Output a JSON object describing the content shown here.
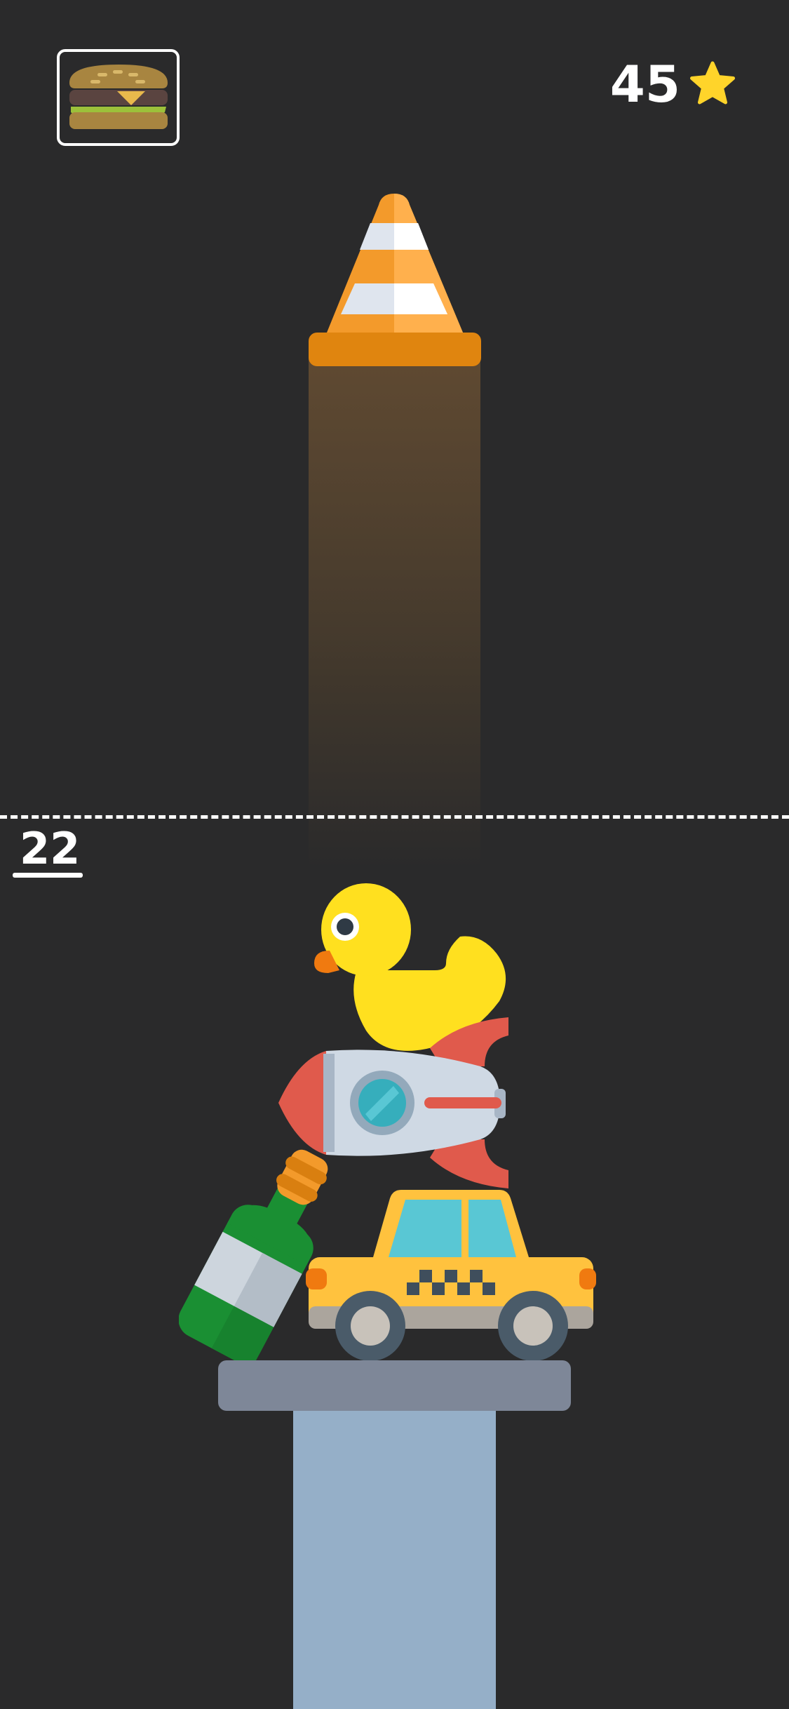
{
  "hud": {
    "next_item_icon": "burger-icon",
    "score": "45",
    "score_icon": "star-icon",
    "height": "22"
  },
  "items": {
    "held": "traffic-cone",
    "stack": [
      "rubber-duck",
      "rocket",
      "champagne-bottle",
      "taxi-car"
    ]
  },
  "colors": {
    "background": "#2a2a2b",
    "star": "#ffd42a",
    "pedestal_top": "#7e8798",
    "pedestal_column": "#95afc8",
    "cone_orange": "#f39a2b",
    "duck_yellow": "#ffe01f",
    "taxi_yellow": "#ffc23e",
    "bottle_green": "#1a8f33",
    "rocket_red": "#e05a4c"
  }
}
